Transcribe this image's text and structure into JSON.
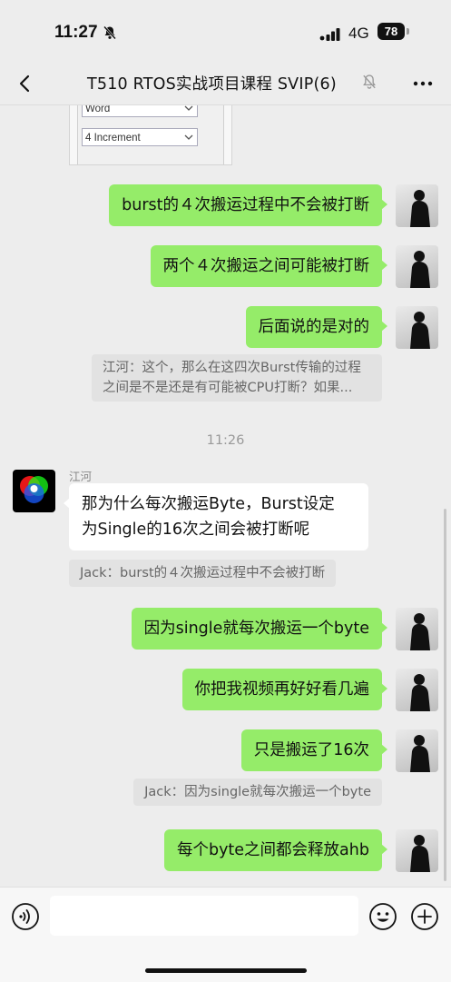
{
  "status_bar": {
    "time": "11:27",
    "network": "4G",
    "battery": "78"
  },
  "nav": {
    "title": "T510 RTOS实战项目课程 SVIP(6)"
  },
  "image_message": {
    "field1": "Word",
    "field2": "4 Increment"
  },
  "messages_top": [
    {
      "text": "burst的４次搬运过程中不会被打断"
    },
    {
      "text": "两个４次搬运之间可能被打断"
    },
    {
      "text": "后面说的是对的"
    }
  ],
  "quote1": {
    "line1": "江河：这个，那么在这四次Burst传输的过程",
    "line2": "之间是不是还是有可能被CPU打断？如果..."
  },
  "timestamp": "11:26",
  "other_message": {
    "sender": "江河",
    "line1": "那为什么每次搬运Byte，Burst设定",
    "line2": "为Single的16次之间会被打断呢"
  },
  "quote2": {
    "text": "Jack：burst的４次搬运过程中不会被打断"
  },
  "messages_mid": [
    {
      "text": "因为single就每次搬运一个byte"
    },
    {
      "text": "你把我视频再好好看几遍"
    },
    {
      "text": "只是搬运了16次"
    }
  ],
  "quote3": {
    "text": "Jack：因为single就每次搬运一个byte"
  },
  "message_last": {
    "text": "每个byte之间都会释放ahb"
  },
  "input": {
    "placeholder": "",
    "value": ""
  },
  "colors": {
    "my_bubble": "#95ec69",
    "other_bubble": "#ffffff",
    "background": "#ededed"
  }
}
